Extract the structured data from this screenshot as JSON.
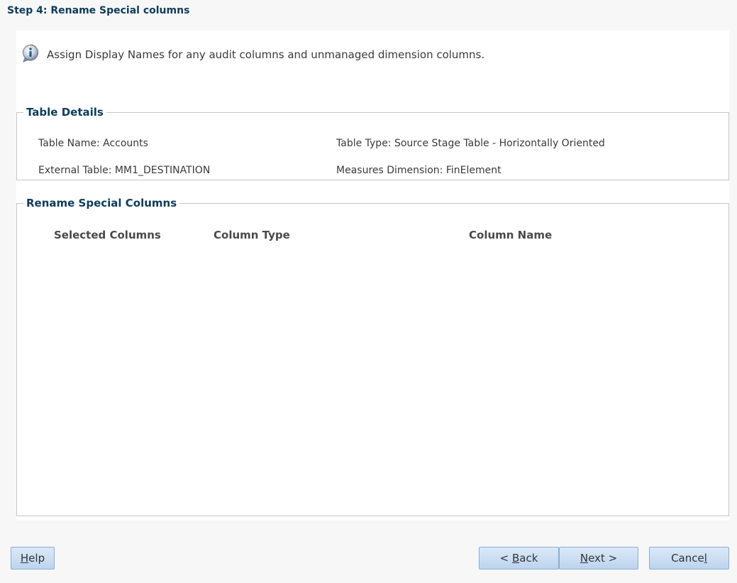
{
  "step_title": "Step 4: Rename Special columns",
  "info": {
    "icon": "info-icon",
    "message": "Assign Display Names for any audit columns and unmanaged dimension columns."
  },
  "table_details": {
    "legend": "Table Details",
    "table_name": "Table Name: Accounts",
    "table_type": "Table Type: Source Stage Table - Horizontally Oriented",
    "external_table": "External Table: MM1_DESTINATION",
    "measures_dimension": "Measures Dimension: FinElement"
  },
  "rename_columns": {
    "legend": "Rename Special Columns",
    "headers": [
      "Selected Columns",
      "Column Type",
      "Column Name"
    ],
    "rows": []
  },
  "buttons": {
    "help": {
      "mnemonic": "H",
      "rest": "elp"
    },
    "back": {
      "prefix": "< ",
      "mnemonic": "B",
      "rest": "ack"
    },
    "next": {
      "mnemonic": "N",
      "rest": "ext >"
    },
    "cancel": {
      "prefix": "Cance",
      "mnemonic": "l"
    }
  },
  "colors": {
    "title": "#0c3c5c",
    "button_bg": "#c8dcf2",
    "button_border": "#8aaed0"
  }
}
